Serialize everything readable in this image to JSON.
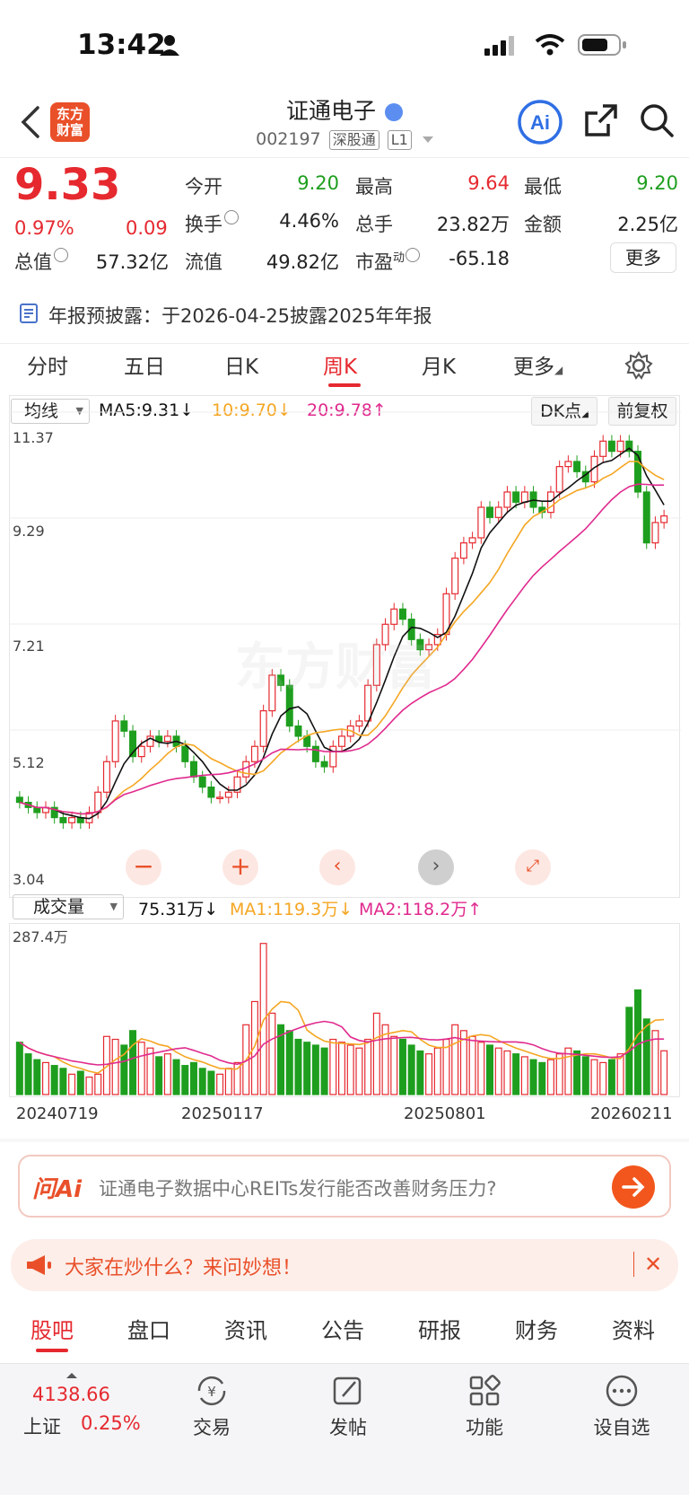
{
  "status": {
    "time": "13:42"
  },
  "header": {
    "logo_text": "东方财富",
    "title": "证通电子",
    "code": "002197",
    "tag_market": "深股通",
    "tag_level": "L1"
  },
  "quote": {
    "price": "9.33",
    "change_pct": "0.97%",
    "change": "0.09",
    "fields": [
      {
        "label": "今开",
        "value": "9.20"
      },
      {
        "label": "最高",
        "value": "9.64"
      },
      {
        "label": "最低",
        "value": "9.20"
      },
      {
        "label": "换手",
        "value": "4.46%"
      },
      {
        "label": "总手",
        "value": "23.82万"
      },
      {
        "label": "金额",
        "value": "2.25亿"
      },
      {
        "label": "总值",
        "value": "57.32亿"
      },
      {
        "label": "流值",
        "value": "49.82亿"
      },
      {
        "label": "市盈",
        "sup": "动",
        "value": "-65.18"
      }
    ],
    "more": "更多"
  },
  "notice": "年报预披露：于2026-04-25披露2025年年报",
  "tabs": [
    "分时",
    "五日",
    "日K",
    "周K",
    "月K",
    "更多"
  ],
  "chart_toolbar": {
    "indicator": "均线",
    "ma5": "MA5:9.31↓",
    "ma10": "10:9.70↓",
    "ma20": "20:9.78↑",
    "dk": "DK点",
    "adjust": "前复权"
  },
  "chart_data": {
    "type": "candlestick",
    "y_ticks": [
      "11.37",
      "9.29",
      "7.21",
      "5.12",
      "3.04"
    ],
    "ylim": [
      3.04,
      11.37
    ],
    "x_labels": [
      "20240719",
      "20250117",
      "20250801",
      "20260211"
    ],
    "watermark": "东方财富",
    "colors": {
      "up": "#e5292f",
      "down": "#1e9e1e",
      "ma5": "#111111",
      "ma10": "#f5a623",
      "ma20": "#e02a8e"
    },
    "closes": [
      3.7,
      3.6,
      3.5,
      3.6,
      3.4,
      3.3,
      3.4,
      3.3,
      3.5,
      3.9,
      4.5,
      5.3,
      5.1,
      4.6,
      4.8,
      5.0,
      4.9,
      5.0,
      4.8,
      4.5,
      4.2,
      4.0,
      3.8,
      3.8,
      3.9,
      4.2,
      4.5,
      4.8,
      5.5,
      6.2,
      6.0,
      5.2,
      5.0,
      4.8,
      4.5,
      4.4,
      4.8,
      5.0,
      5.2,
      5.3,
      6.0,
      6.8,
      7.2,
      7.5,
      7.3,
      6.9,
      6.7,
      6.8,
      7.0,
      7.8,
      8.5,
      8.8,
      8.9,
      9.5,
      9.3,
      9.5,
      9.8,
      9.6,
      9.8,
      9.5,
      9.4,
      9.8,
      10.3,
      10.4,
      10.2,
      10.0,
      10.5,
      10.8,
      10.6,
      10.8,
      10.6,
      9.8,
      8.8,
      9.2,
      9.33
    ]
  },
  "volume": {
    "indicator": "成交量",
    "current": "75.31万↓",
    "ma1": "MA1:119.3万↓",
    "ma2": "MA2:118.2万↑",
    "max_label": "287.4万",
    "max": 287.4,
    "values": [
      90,
      70,
      60,
      55,
      50,
      45,
      35,
      40,
      30,
      35,
      100,
      95,
      85,
      110,
      90,
      80,
      65,
      70,
      60,
      50,
      55,
      45,
      40,
      35,
      45,
      55,
      120,
      160,
      260,
      140,
      120,
      110,
      95,
      90,
      85,
      80,
      95,
      90,
      85,
      80,
      95,
      140,
      120,
      100,
      95,
      85,
      75,
      70,
      80,
      95,
      120,
      110,
      100,
      90,
      85,
      80,
      75,
      70,
      65,
      60,
      55,
      60,
      70,
      80,
      75,
      65,
      60,
      55,
      60,
      70,
      150,
      180,
      130,
      110,
      75.31
    ]
  },
  "ask": {
    "brand": "问Ai",
    "text": "证通电子数据中心REITs发行能否改善财务压力?"
  },
  "hot": {
    "text": "大家在炒什么？来问妙想！"
  },
  "bottom_tabs": [
    "股吧",
    "盘口",
    "资讯",
    "公告",
    "研报",
    "财务",
    "资料"
  ],
  "bottom_bar": {
    "index_value": "4138.66",
    "index_name": "上证",
    "index_change": "0.25%",
    "items": [
      "交易",
      "发帖",
      "功能",
      "设自选"
    ]
  }
}
